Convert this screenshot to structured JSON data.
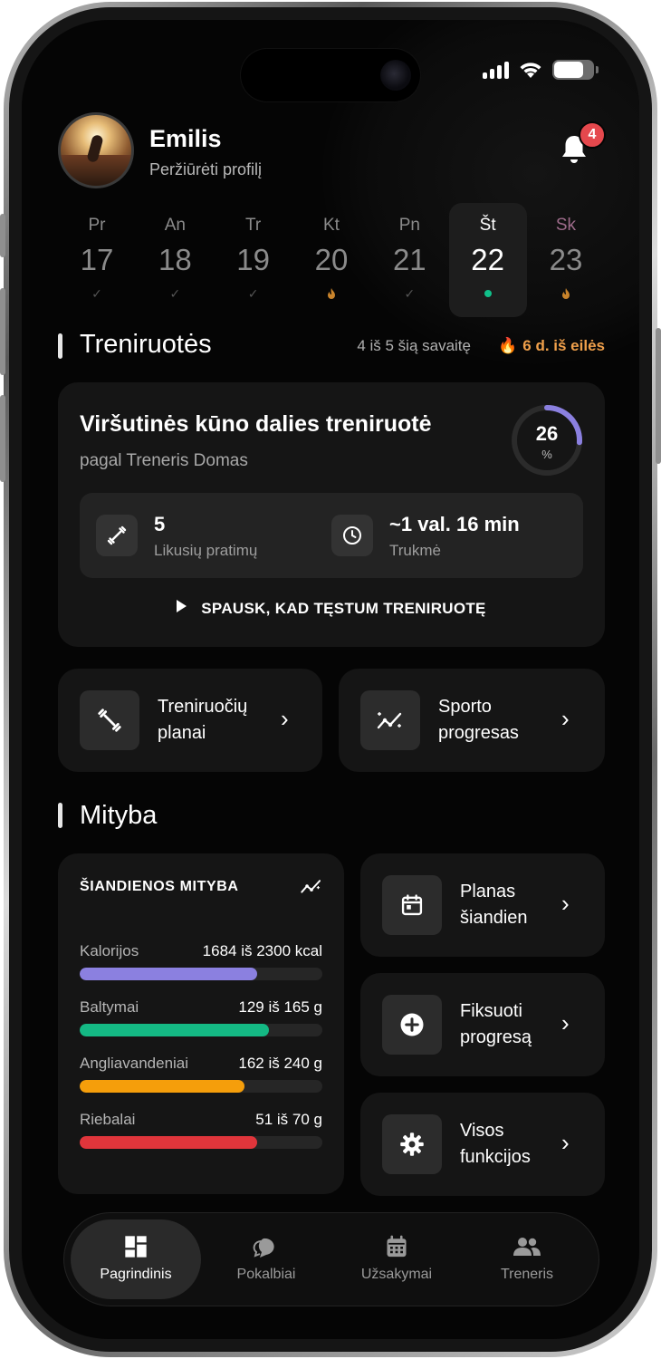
{
  "profile": {
    "name": "Emilis",
    "link": "Peržiūrėti profilį"
  },
  "notifications": {
    "count": "4"
  },
  "week": [
    {
      "dn": "Pr",
      "dd": "17",
      "mark": "check"
    },
    {
      "dn": "An",
      "dd": "18",
      "mark": "check"
    },
    {
      "dn": "Tr",
      "dd": "19",
      "mark": "check"
    },
    {
      "dn": "Kt",
      "dd": "20",
      "mark": "flame"
    },
    {
      "dn": "Pn",
      "dd": "21",
      "mark": "check"
    },
    {
      "dn": "Št",
      "dd": "22",
      "mark": "dot",
      "active": true
    },
    {
      "dn": "Sk",
      "dd": "23",
      "mark": "flame"
    }
  ],
  "workouts": {
    "section_title": "Treniruotės",
    "week_progress": "4 iš 5 šią savaitę",
    "streak": "6 d. iš eilės",
    "card": {
      "title": "Viršutinės kūno dalies treniruotė",
      "subtitle": "pagal Treneris Domas",
      "progress_value": "26",
      "progress_unit": "%",
      "progress_fraction": 0.26,
      "exercises_value": "5",
      "exercises_label": "Likusių pratimų",
      "duration_value": "~1 val. 16 min",
      "duration_label": "Trukmė",
      "continue_label": "SPAUSK, KAD TĘSTUM TRENIRUOTĘ"
    },
    "tiles": {
      "plans_l1": "Treniruočių",
      "plans_l2": "planai",
      "progress_l1": "Sporto",
      "progress_l2": "progresas"
    }
  },
  "nutrition": {
    "section_title": "Mityba",
    "card_title": "ŠIANDIENOS MITYBA",
    "rows": [
      {
        "label": "Kalorijos",
        "value": "1684 iš 2300 kcal",
        "fraction": 0.73,
        "color": "#8b80e0"
      },
      {
        "label": "Baltymai",
        "value": "129 iš 165 g",
        "fraction": 0.78,
        "color": "#14b984"
      },
      {
        "label": "Angliavandeniai",
        "value": "162 iš 240 g",
        "fraction": 0.68,
        "color": "#f59e0b"
      },
      {
        "label": "Riebalai",
        "value": "51 iš 70 g",
        "fraction": 0.73,
        "color": "#e0353b"
      }
    ],
    "tiles": {
      "plan_l1": "Planas",
      "plan_l2": "šiandien",
      "track_l1": "Fiksuoti",
      "track_l2": "progresą",
      "all_l1": "Visos",
      "all_l2": "funkcijos"
    }
  },
  "nav": {
    "home": "Pagrindinis",
    "chats": "Pokalbiai",
    "orders": "Užsakymai",
    "trainer": "Treneris"
  },
  "colors": {
    "accent_ring": "#8b80e0",
    "streak": "#f0a04b",
    "badge": "#e5484d",
    "active_dot": "#10c08a"
  }
}
